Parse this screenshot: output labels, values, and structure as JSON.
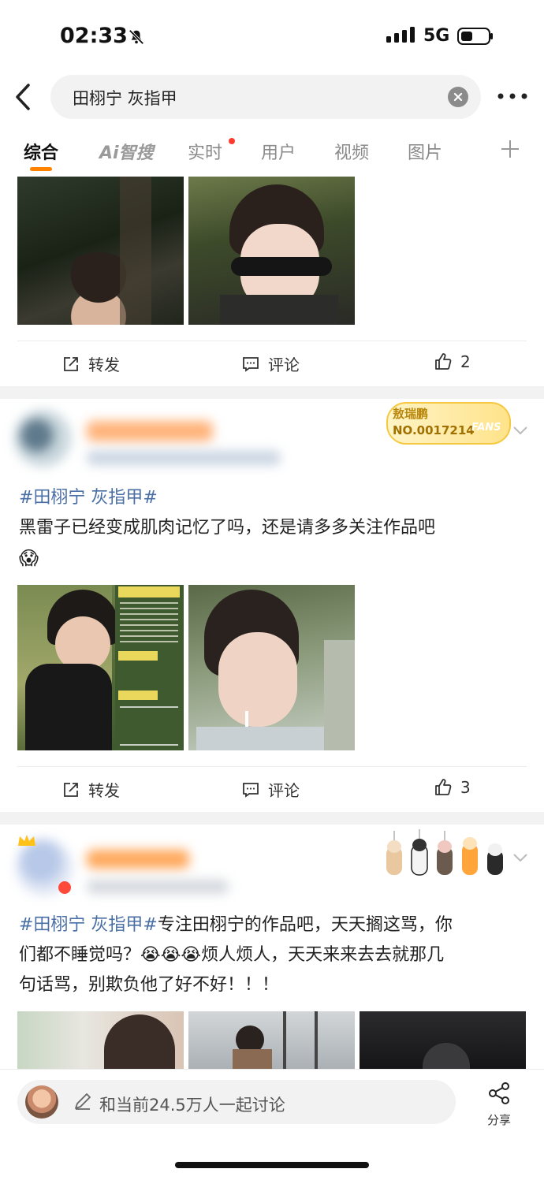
{
  "status": {
    "time": "02:33",
    "network": "5G"
  },
  "search": {
    "query": "田栩宁 灰指甲"
  },
  "tabs": [
    {
      "label": "综合"
    },
    {
      "label": "Ai智搜"
    },
    {
      "label": "实时"
    },
    {
      "label": "用户"
    },
    {
      "label": "视频"
    },
    {
      "label": "图片"
    }
  ],
  "post1": {
    "repost_label": "转发",
    "comment_label": "评论",
    "like_count": "2"
  },
  "post2": {
    "fan_badge": {
      "name": "敖瑞鹏",
      "number": "NO.0017214",
      "tag": "FANS"
    },
    "hashtag": "#田栩宁 灰指甲#",
    "text": "黑雷子已经变成肌肉记忆了吗，还是请多多关注作品吧",
    "emoji": "😱",
    "repost_label": "转发",
    "comment_label": "评论",
    "like_count": "3"
  },
  "post3": {
    "hashtag": "#田栩宁 灰指甲#",
    "text_line1_rest": "专注田栩宁的作品吧，天天搁这骂，你",
    "text_line2_a": "们都不睡觉吗？",
    "text_line2_emoji": "😭😭😭",
    "text_line2_b": "烦人烦人，天天来来去去就那几",
    "text_line3": "句话骂，别欺负他了好不好！！！"
  },
  "bottom": {
    "discuss_placeholder": "和当前24.5万人一起讨论",
    "share_label": "分享"
  },
  "colors": {
    "accent": "#ff8200",
    "hashtag": "#4a6fa5",
    "badge": "#f5c842"
  }
}
